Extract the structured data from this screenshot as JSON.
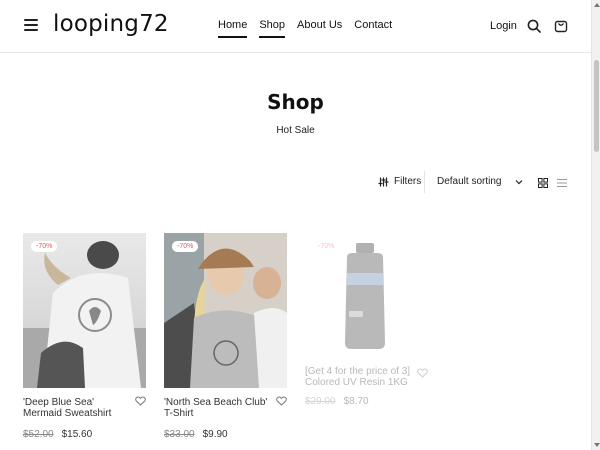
{
  "header": {
    "logo": "looping72",
    "nav": [
      {
        "label": "Home",
        "active": true
      },
      {
        "label": "Shop",
        "active": true
      },
      {
        "label": "About Us",
        "active": false
      },
      {
        "label": "Contact",
        "active": false
      }
    ],
    "login_label": "Login",
    "icons": [
      "menu-icon",
      "search-icon",
      "cart-icon"
    ]
  },
  "page": {
    "title": "Shop",
    "subtitle": "Hot Sale"
  },
  "toolbar": {
    "filters_label": "Filters",
    "sorting": "Default sorting",
    "view_icons": [
      "grid-view-icon",
      "list-view-icon"
    ]
  },
  "products": [
    {
      "badge": "-70%",
      "name": "'Deep Blue Sea' Mermaid Sweatshirt",
      "old_price": "$52.00",
      "new_price": "$15.60"
    },
    {
      "badge": "-70%",
      "name": "'North Sea Beach Club' T-Shirt",
      "old_price": "$33.00",
      "new_price": "$9.90"
    },
    {
      "badge": "-70%",
      "name": "[Get 4 for the price of 3] Colored UV Resin 1KG",
      "old_price": "$29.00",
      "new_price": "$8.70"
    }
  ],
  "colors": {
    "accent": "#111111",
    "badge_text": "#e05a5a",
    "border": "#e6e6e6"
  }
}
